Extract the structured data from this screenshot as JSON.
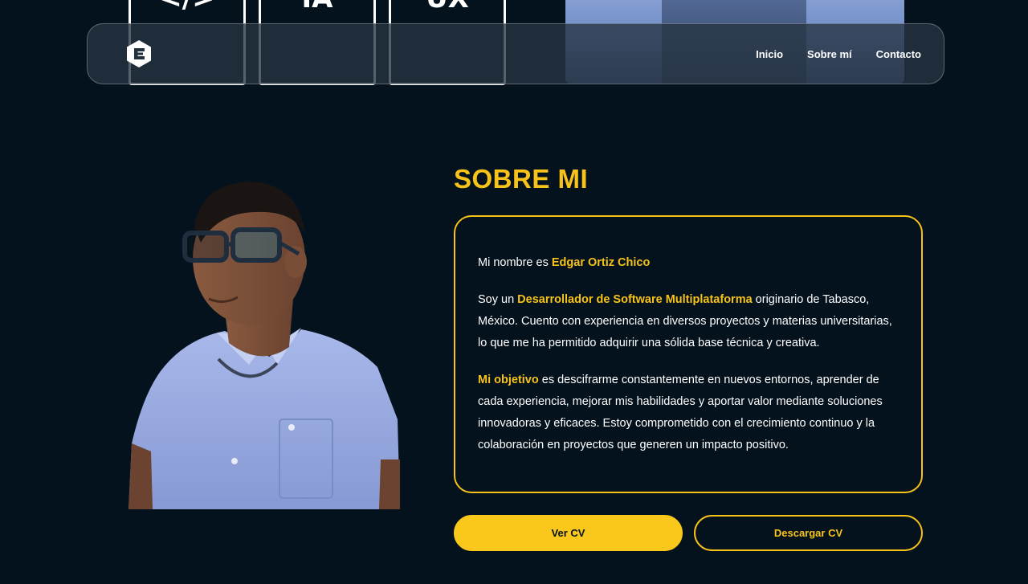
{
  "background_tiles": [
    {
      "label": "</>"
    },
    {
      "label": "IA"
    },
    {
      "label": "UX"
    }
  ],
  "navbar": {
    "logo_icon": "hexagon-e-logo",
    "links": [
      {
        "label": "Inicio"
      },
      {
        "label": "Sobre mí"
      },
      {
        "label": "Contacto"
      }
    ]
  },
  "about": {
    "title": "SOBRE MI",
    "photo_alt": "Edgar Ortiz Chico",
    "p1": {
      "before": "Mi nombre es ",
      "name": "Edgar Ortiz Chico"
    },
    "p2": {
      "before": "Soy un ",
      "highlight": "Desarrollador de Software Multiplataforma",
      "after": " originario de Tabasco, México. Cuento con experiencia en diversos proyectos y materias universitarias, lo que me ha permitido adquirir una sólida base técnica y creativa."
    },
    "p3": {
      "highlight": "Mi objetivo",
      "after": " es descifrarme constantemente en nuevos entornos, aprender de cada experiencia, mejorar mis habilidades y aportar valor mediante soluciones innovadoras y eficaces. Estoy comprometido con el crecimiento continuo y la colaboración en proyectos que generen un impacto positivo."
    },
    "buttons": {
      "view_cv": "Ver CV",
      "download_cv": "Descargar CV"
    }
  },
  "colors": {
    "background": "#04121d",
    "accent": "#f7c21a",
    "text": "#ffffff"
  }
}
